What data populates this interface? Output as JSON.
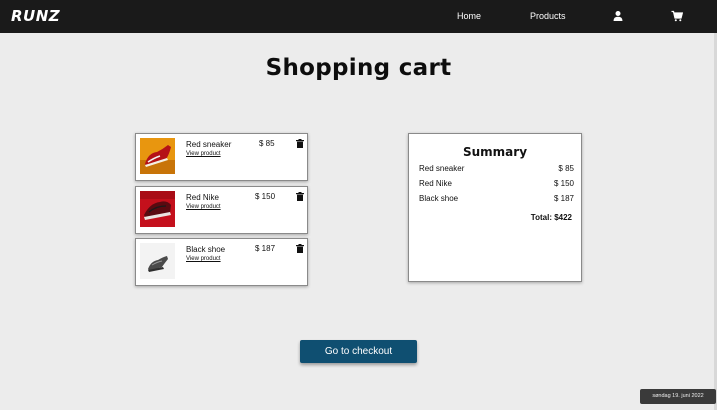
{
  "nav": {
    "logo": "RUNZ",
    "links": [
      "Home",
      "Products"
    ],
    "icons": [
      "user-icon",
      "cart-icon"
    ]
  },
  "page": {
    "title": "Shopping cart"
  },
  "cart": {
    "view_link_label": "View product",
    "items": [
      {
        "name": "Red sneaker",
        "price": "$ 85",
        "image": "red-sneaker-photo"
      },
      {
        "name": "Red Nike",
        "price": "$ 150",
        "image": "red-nike-photo"
      },
      {
        "name": "Black shoe",
        "price": "$ 187",
        "image": "black-shoe-photo"
      }
    ],
    "remove_icon": "trash-icon"
  },
  "summary": {
    "title": "Summary",
    "rows": [
      {
        "name": "Red sneaker",
        "price": "$ 85"
      },
      {
        "name": "Red Nike",
        "price": "$ 150"
      },
      {
        "name": "Black shoe",
        "price": "$ 187"
      }
    ],
    "total": "Total: $422"
  },
  "checkout": {
    "label": "Go to checkout"
  },
  "taskbar": {
    "date": "søndag 19. juni 2022"
  },
  "colors": {
    "navbar": "#1a1a1a",
    "background": "#ececec",
    "checkout_button": "#0f4f71"
  }
}
